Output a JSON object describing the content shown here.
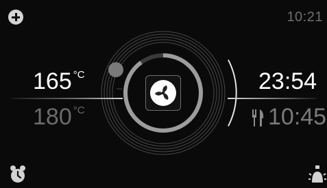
{
  "status_bar": {
    "clock": "10:21"
  },
  "temperature": {
    "current_value": "165",
    "current_unit": "°C",
    "target_value": "180",
    "target_unit": "°C",
    "progress_fraction": 0.9
  },
  "timer": {
    "remaining": "23:54",
    "end_time": "10:45"
  },
  "icons": {
    "add": "add-circle-icon",
    "fan": "fan-mode-icon",
    "cutlery": "cutlery-icon",
    "alarm": "alarm-clock-icon",
    "lamp": "oven-lamp-icon"
  },
  "colors": {
    "background": "#0a0a0a",
    "primary_text": "#ffffff",
    "secondary_text": "#6b6b6b",
    "accent_grey": "#9c9c9c"
  }
}
